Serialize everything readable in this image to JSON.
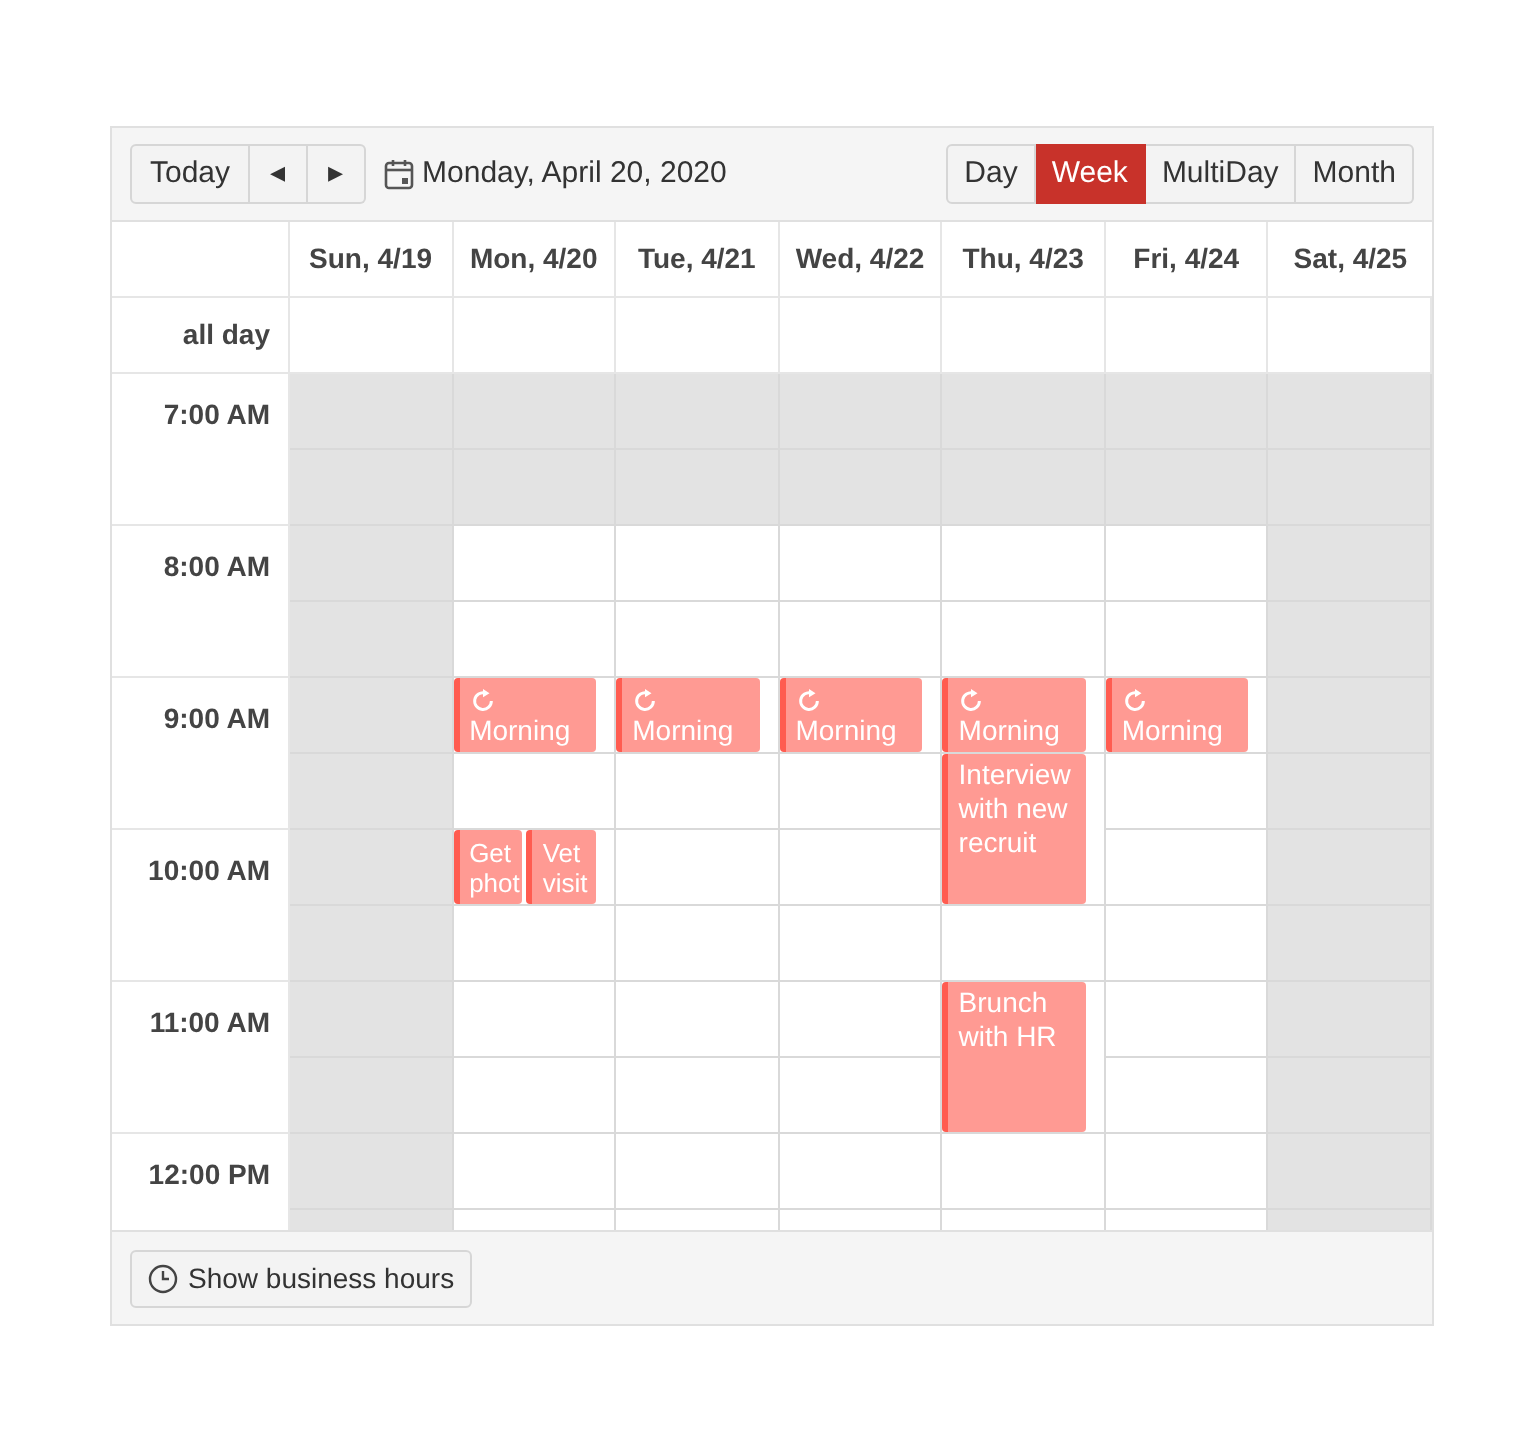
{
  "toolbar": {
    "today": "Today",
    "prev": "◂",
    "next": "▸",
    "date": "Monday, April 20, 2020",
    "views": [
      {
        "label": "Day",
        "selected": false
      },
      {
        "label": "Week",
        "selected": true
      },
      {
        "label": "MultiDay",
        "selected": false
      },
      {
        "label": "Month",
        "selected": false
      }
    ]
  },
  "all_day_label": "all day",
  "days": [
    {
      "label": "Sun, 4/19"
    },
    {
      "label": "Mon, 4/20"
    },
    {
      "label": "Tue, 4/21"
    },
    {
      "label": "Wed, 4/22"
    },
    {
      "label": "Thu, 4/23"
    },
    {
      "label": "Fri, 4/24"
    },
    {
      "label": "Sat, 4/25"
    }
  ],
  "hours": [
    {
      "label": "7:00 AM",
      "halves": [
        {
          "cells": [
            {
              "nonworking": true
            },
            {
              "nonworking": true
            },
            {
              "nonworking": true
            },
            {
              "nonworking": true
            },
            {
              "nonworking": true
            },
            {
              "nonworking": true
            },
            {
              "nonworking": true
            }
          ]
        },
        {
          "cells": [
            {
              "nonworking": true
            },
            {
              "nonworking": true
            },
            {
              "nonworking": true
            },
            {
              "nonworking": true
            },
            {
              "nonworking": true
            },
            {
              "nonworking": true
            },
            {
              "nonworking": true
            }
          ]
        }
      ]
    },
    {
      "label": "8:00 AM",
      "halves": [
        {
          "cells": [
            {
              "nonworking": true
            },
            {
              "nonworking": false
            },
            {
              "nonworking": false
            },
            {
              "nonworking": false
            },
            {
              "nonworking": false
            },
            {
              "nonworking": false
            },
            {
              "nonworking": true
            }
          ]
        },
        {
          "cells": [
            {
              "nonworking": true
            },
            {
              "nonworking": false
            },
            {
              "nonworking": false
            },
            {
              "nonworking": false
            },
            {
              "nonworking": false
            },
            {
              "nonworking": false
            },
            {
              "nonworking": true
            }
          ]
        }
      ]
    },
    {
      "label": "9:00 AM",
      "halves": [
        {
          "cells": [
            {
              "nonworking": true
            },
            {
              "nonworking": false,
              "events": [
                {
                  "title": "Morning",
                  "kind": "half_hour",
                  "recurring": true
                }
              ]
            },
            {
              "nonworking": false,
              "events": [
                {
                  "title": "Morning",
                  "kind": "half_hour",
                  "recurring": true
                }
              ]
            },
            {
              "nonworking": false,
              "events": [
                {
                  "title": "Morning",
                  "kind": "half_hour",
                  "recurring": true
                }
              ]
            },
            {
              "nonworking": false,
              "events": [
                {
                  "title": "Morning",
                  "kind": "half_hour",
                  "recurring": true
                }
              ]
            },
            {
              "nonworking": false,
              "events": [
                {
                  "title": "Morning",
                  "kind": "half_hour",
                  "recurring": true
                }
              ]
            },
            {
              "nonworking": true
            }
          ]
        },
        {
          "cells": [
            {
              "nonworking": true
            },
            {
              "nonworking": false
            },
            {
              "nonworking": false
            },
            {
              "nonworking": false
            },
            {
              "nonworking": false,
              "events": [
                {
                  "title": "Interview with new recruit",
                  "kind": "hour",
                  "recurring": false
                }
              ]
            },
            {
              "nonworking": false
            },
            {
              "nonworking": true
            }
          ]
        }
      ]
    },
    {
      "label": "10:00 AM",
      "halves": [
        {
          "cells": [
            {
              "nonworking": true
            },
            {
              "nonworking": false,
              "events": [
                {
                  "title": "Get phot",
                  "kind": "half_hour",
                  "recurring": false
                },
                {
                  "title": "Vet visit",
                  "kind": "half_hour",
                  "recurring": false
                }
              ]
            },
            {
              "nonworking": false
            },
            {
              "nonworking": false
            },
            {},
            {
              "nonworking": false
            },
            {
              "nonworking": true
            }
          ]
        },
        {
          "cells": [
            {
              "nonworking": true
            },
            {
              "nonworking": false
            },
            {
              "nonworking": false
            },
            {
              "nonworking": false
            },
            {
              "nonworking": false
            },
            {
              "nonworking": false
            },
            {
              "nonworking": true
            }
          ]
        }
      ]
    },
    {
      "label": "11:00 AM",
      "halves": [
        {
          "cells": [
            {
              "nonworking": true
            },
            {
              "nonworking": false
            },
            {
              "nonworking": false
            },
            {
              "nonworking": false
            },
            {
              "nonworking": false,
              "events": [
                {
                  "title": "Brunch with HR",
                  "kind": "hour",
                  "recurring": false
                }
              ]
            },
            {
              "nonworking": false
            },
            {
              "nonworking": true
            }
          ]
        },
        {
          "cells": [
            {
              "nonworking": true
            },
            {
              "nonworking": false
            },
            {
              "nonworking": false
            },
            {
              "nonworking": false
            },
            {},
            {
              "nonworking": false
            },
            {
              "nonworking": true
            }
          ]
        }
      ]
    },
    {
      "label": "12:00 PM",
      "halves": [
        {
          "cells": [
            {
              "nonworking": true
            },
            {
              "nonworking": false
            },
            {
              "nonworking": false
            },
            {
              "nonworking": false
            },
            {
              "nonworking": false
            },
            {
              "nonworking": false
            },
            {
              "nonworking": true
            }
          ]
        },
        {
          "cells": [
            {
              "nonworking": true
            },
            {
              "nonworking": false
            },
            {
              "nonworking": false
            },
            {
              "nonworking": false
            },
            {
              "nonworking": false
            },
            {
              "nonworking": false
            },
            {
              "nonworking": true
            }
          ]
        }
      ]
    }
  ],
  "footer": {
    "button": "Show business hours"
  }
}
